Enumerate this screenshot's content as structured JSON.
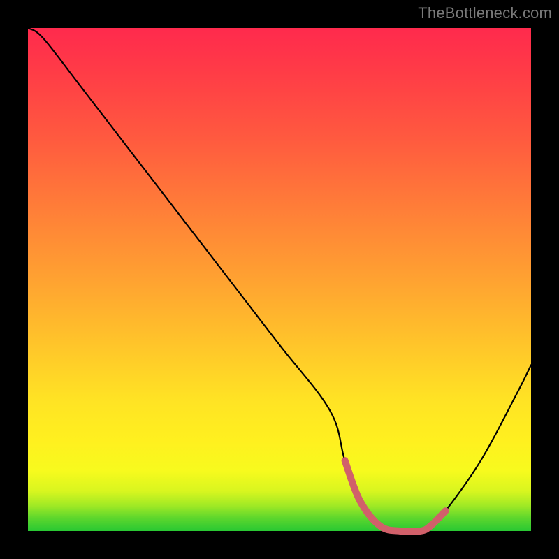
{
  "watermark": "TheBottleneck.com",
  "chart_data": {
    "type": "line",
    "title": "",
    "xlabel": "",
    "ylabel": "",
    "xlim": [
      0,
      100
    ],
    "ylim": [
      0,
      100
    ],
    "grid": false,
    "legend": false,
    "series": [
      {
        "name": "bottleneck-curve",
        "x": [
          0,
          3,
          10,
          20,
          30,
          40,
          50,
          60,
          63,
          66,
          70,
          74,
          78,
          80,
          83,
          90,
          97,
          100
        ],
        "y": [
          100,
          98,
          89,
          76,
          63,
          50,
          37,
          24,
          14,
          6,
          1,
          0,
          0,
          1,
          4,
          14,
          27,
          33
        ]
      },
      {
        "name": "optimal-range-marker",
        "x": [
          63,
          66,
          70,
          74,
          78,
          80,
          83
        ],
        "y": [
          14,
          6,
          1,
          0,
          0,
          1,
          4
        ]
      }
    ],
    "colors": {
      "curve": "#000000",
      "marker": "#d1606a",
      "gradient_top": "#ff2a4d",
      "gradient_bottom": "#28c833"
    }
  }
}
